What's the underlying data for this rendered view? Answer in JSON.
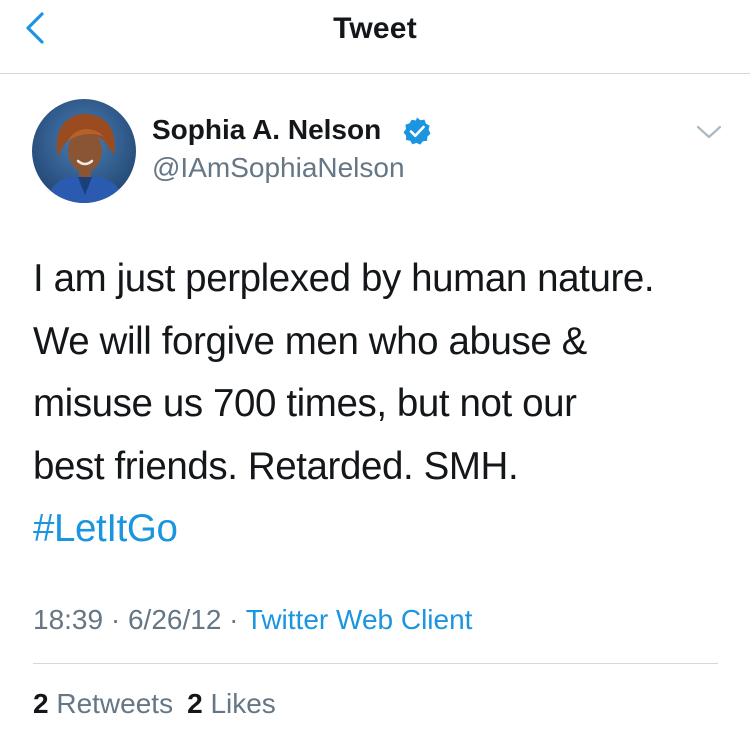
{
  "header": {
    "title": "Tweet",
    "back_icon": "chevron-left-icon",
    "accent_color": "#1b95e0"
  },
  "author": {
    "name": "Sophia A. Nelson",
    "handle": "@IAmSophiaNelson",
    "verified": true,
    "avatar_icon": "profile-photo"
  },
  "tweet": {
    "lines": [
      "I am just perplexed by human nature.",
      "We will forgive men who abuse &",
      "misuse us 700 times, but not our",
      "best friends. Retarded. SMH."
    ],
    "hashtag": "#LetItGo"
  },
  "meta": {
    "time": "18:39",
    "date": "6/26/12",
    "separator": " · ",
    "source": "Twitter Web Client"
  },
  "stats": {
    "retweets_count": "2",
    "retweets_label": "Retweets",
    "likes_count": "2",
    "likes_label": "Likes"
  }
}
